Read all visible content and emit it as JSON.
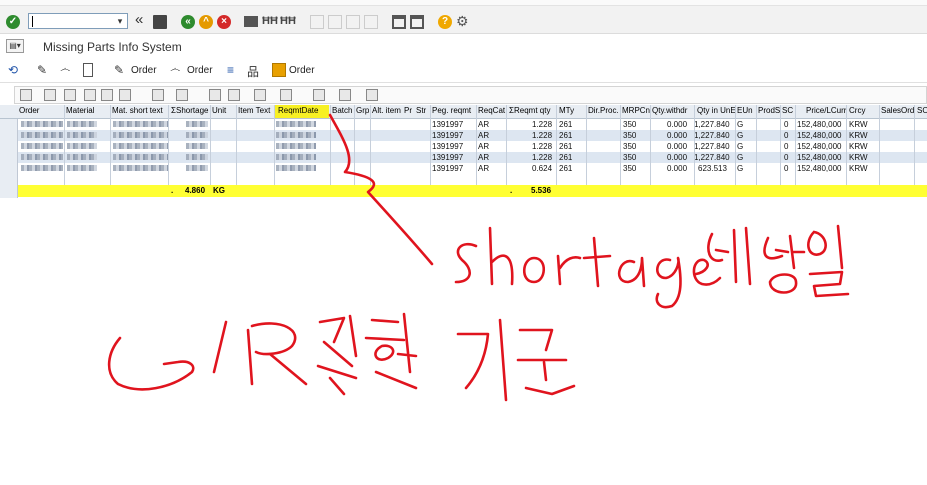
{
  "app": {
    "title": "Missing Parts Info System"
  },
  "toolbar": {
    "order_label_1": "Order",
    "order_label_2": "Order",
    "order_label_3": "Order"
  },
  "table": {
    "columns": [
      "Order",
      "Material",
      "Mat. short text",
      "Shortage",
      "Unit",
      "Item Text",
      "ReqmtDate",
      "Batch",
      "Grp",
      "Alt. item",
      "Pr",
      "Str",
      "Peg. reqmt",
      "ReqCat",
      "Reqmt qty",
      "MTy",
      "Dir.Proc.",
      "MRPCn",
      "Qty.withdr",
      "Qty in UnE",
      "EUn",
      "ProdS",
      "SC",
      "Price/LCurr",
      "Crcy",
      "SalesOrd",
      "SO"
    ],
    "sigma_shortage": "Σ",
    "sigma_reqmt": "Σ",
    "rows": [
      {
        "peg": "1391997",
        "reqcat": "AR",
        "reqqty": "1.228",
        "mty": "261",
        "mrpcn": "350",
        "qtyw": "0.000",
        "qtyu": "1,227.840",
        "eun": "G",
        "sc": "0",
        "price": "152,480,000",
        "crcy": "KRW"
      },
      {
        "peg": "1391997",
        "reqcat": "AR",
        "reqqty": "1.228",
        "mty": "261",
        "mrpcn": "350",
        "qtyw": "0.000",
        "qtyu": "1,227.840",
        "eun": "G",
        "sc": "0",
        "price": "152,480,000",
        "crcy": "KRW"
      },
      {
        "peg": "1391997",
        "reqcat": "AR",
        "reqqty": "1.228",
        "mty": "261",
        "mrpcn": "350",
        "qtyw": "0.000",
        "qtyu": "1,227.840",
        "eun": "G",
        "sc": "0",
        "price": "152,480,000",
        "crcy": "KRW"
      },
      {
        "peg": "1391997",
        "reqcat": "AR",
        "reqqty": "1.228",
        "mty": "261",
        "mrpcn": "350",
        "qtyw": "0.000",
        "qtyu": "1,227.840",
        "eun": "G",
        "sc": "0",
        "price": "152,480,000",
        "crcy": "KRW"
      },
      {
        "peg": "1391997",
        "reqcat": "AR",
        "reqqty": "0.624",
        "mty": "261",
        "mrpcn": "350",
        "qtyw": "0.000",
        "qtyu": "623.513",
        "eun": "G",
        "sc": "0",
        "price": "152,480,000",
        "crcy": "KRW"
      }
    ],
    "total": {
      "dot_a": ".",
      "shortage": "4.860",
      "unit": "KG",
      "dot_b": ".",
      "reqmt": "5.536"
    }
  },
  "annotation": {
    "text_top": "Shortage 예상일",
    "text_bottom": "GR 잡힌 기준",
    "color": "#e0141e"
  },
  "colors": {
    "highlight": "#ffff33",
    "row_alt": "#dde6f1"
  }
}
